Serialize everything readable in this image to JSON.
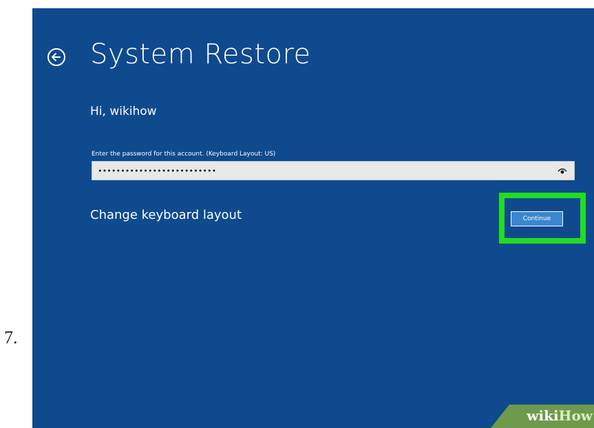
{
  "step": {
    "number": "7."
  },
  "screen": {
    "title": "System Restore",
    "greeting": "Hi, wikihow",
    "password": {
      "label": "Enter the password for this account. (Keyboard Layout: US)",
      "value": "••••••••••••••••••••••••••"
    },
    "change_layout_label": "Change keyboard layout",
    "continue_label": "Continue",
    "icons": {
      "back": "back-arrow-icon",
      "reveal": "eye-icon"
    },
    "colors": {
      "background": "#0f4a8f",
      "highlight": "#22dd22",
      "button": "#3a87cf"
    }
  },
  "watermark": {
    "text_wiki": "wiki",
    "text_how": "How"
  }
}
